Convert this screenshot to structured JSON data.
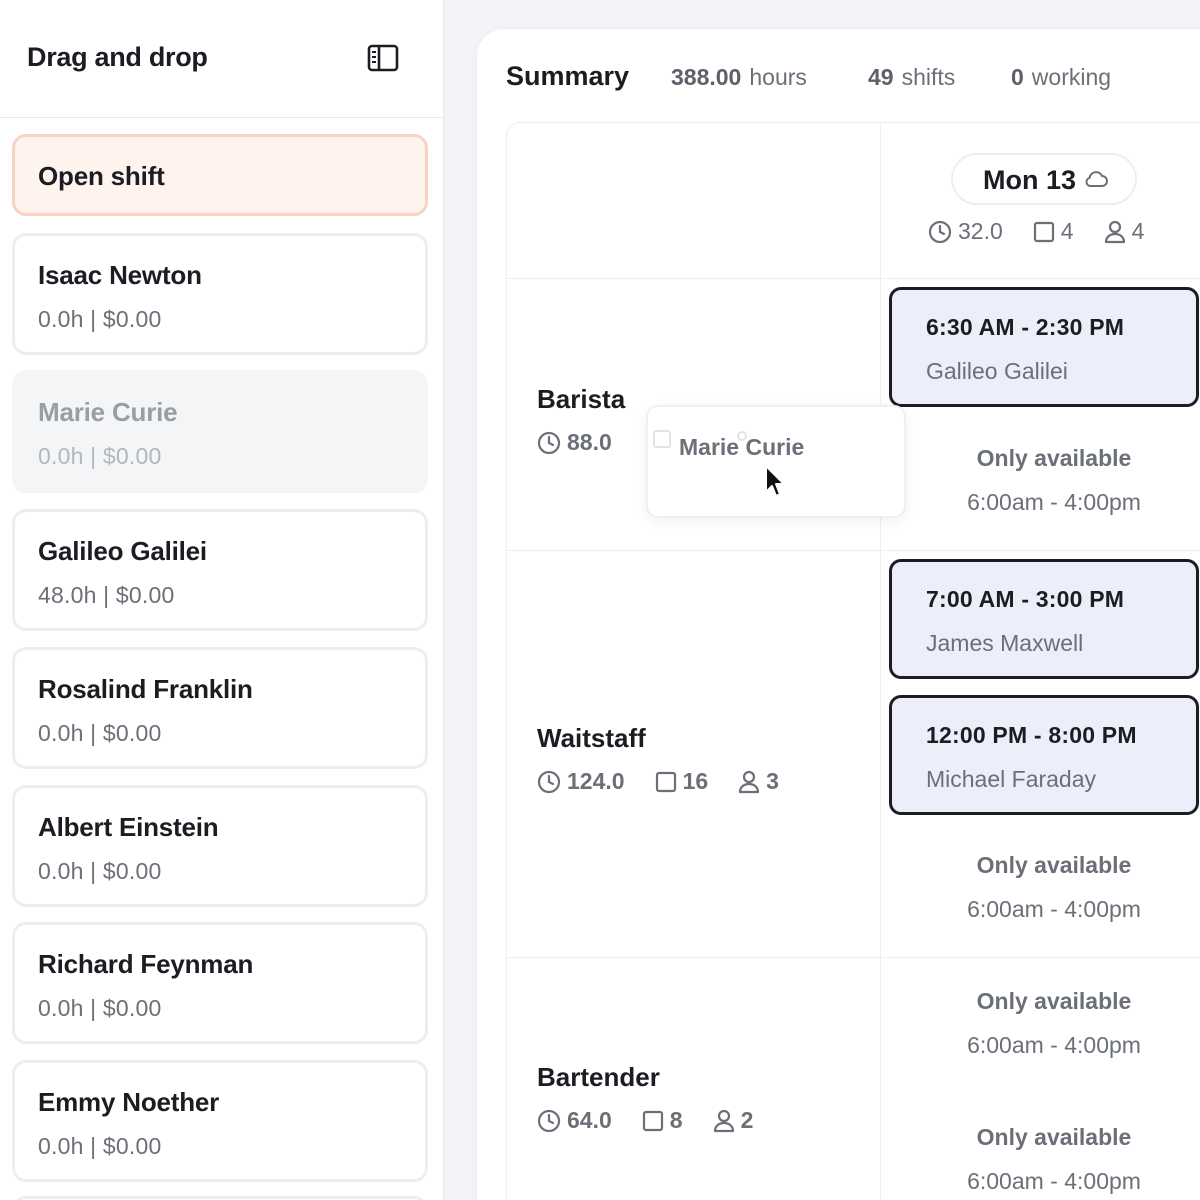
{
  "sidebar": {
    "title": "Drag and drop",
    "toggle_icon": "sidebar-panel-icon",
    "open_shift_label": "Open shift",
    "employees": [
      {
        "name": "Isaac Newton",
        "meta": "0.0h | $0.00"
      },
      {
        "name": "Marie Curie",
        "meta": "0.0h | $0.00"
      },
      {
        "name": "Galileo Galilei",
        "meta": "48.0h | $0.00"
      },
      {
        "name": "Rosalind Franklin",
        "meta": "0.0h | $0.00"
      },
      {
        "name": "Albert Einstein",
        "meta": "0.0h | $0.00"
      },
      {
        "name": "Richard Feynman",
        "meta": "0.0h | $0.00"
      },
      {
        "name": "Emmy Noether",
        "meta": "0.0h | $0.00"
      }
    ]
  },
  "summary": {
    "title": "Summary",
    "hours_value": "388.00",
    "hours_label": "hours",
    "shifts_value": "49",
    "shifts_label": "shifts",
    "working_value": "0",
    "working_label": "working"
  },
  "day": {
    "label": "Mon 13",
    "weather_icon": "cloud-icon",
    "hours": "32.0",
    "shifts": "4",
    "people": "4"
  },
  "roles": [
    {
      "name": "Barista",
      "hours": "88.0"
    },
    {
      "name": "Waitstaff",
      "hours": "124.0",
      "shifts": "16",
      "people": "3"
    },
    {
      "name": "Bartender",
      "hours": "64.0",
      "shifts": "8",
      "people": "2"
    }
  ],
  "shifts": [
    {
      "time": "6:30 AM - 2:30 PM",
      "employee": "Galileo Galilei"
    },
    {
      "time": "7:00 AM - 3:00 PM",
      "employee": "James Maxwell"
    },
    {
      "time": "12:00 PM - 8:00 PM",
      "employee": "Michael Faraday"
    }
  ],
  "availability": {
    "label": "Only available",
    "hours": "6:00am - 4:00pm"
  },
  "drag_ghost": {
    "name": "Marie Curie"
  },
  "colors": {
    "open_shift_bg": "#fff3ee",
    "open_shift_border": "#f8d3c4",
    "shift_bg": "#eceffa",
    "shift_border": "#1b1d22"
  }
}
